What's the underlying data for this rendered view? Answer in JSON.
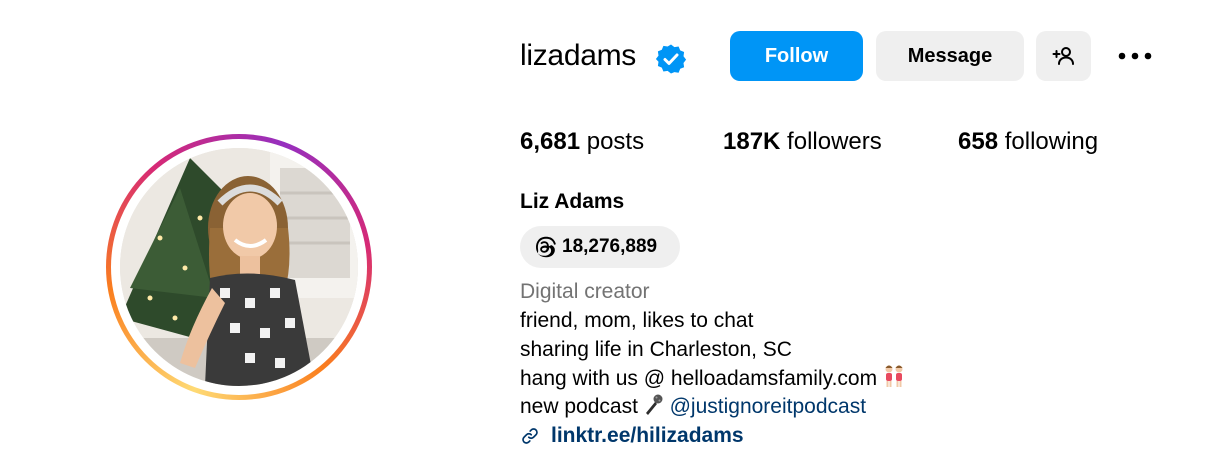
{
  "profile": {
    "username": "lizadams",
    "verified_icon": "verified-badge-icon",
    "accent_color": "#0095f6",
    "buttons": {
      "follow": "Follow",
      "message": "Message",
      "add_user_icon": "add-user-icon",
      "more_icon": "more-options-icon"
    },
    "stats": {
      "posts_count": "6,681",
      "posts_label": "posts",
      "followers_count": "187K",
      "followers_label": "followers",
      "following_count": "658",
      "following_label": "following"
    },
    "full_name": "Liz Adams",
    "threads": {
      "icon": "threads-icon",
      "count": "18,276,889"
    },
    "category": "Digital creator",
    "bio": {
      "line1": "friend, mom, likes to chat",
      "line2": "sharing life in Charleston, SC",
      "line3": "hang with us @ helloadamsfamily.com",
      "line4_prefix": "new podcast",
      "line4_mention": "@justignoreitpodcast"
    },
    "link": {
      "icon": "link-icon",
      "text": "linktr.ee/hilizadams"
    }
  }
}
